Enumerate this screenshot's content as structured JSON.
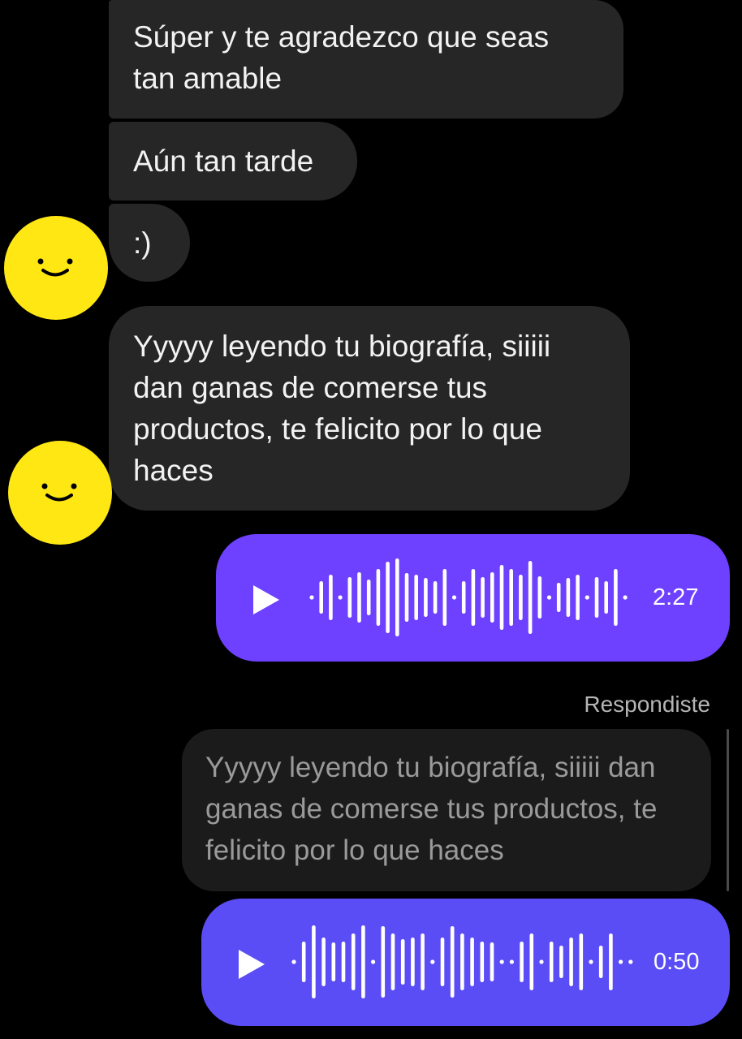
{
  "messages_received": [
    {
      "lines": [
        "Súper y te agradezco que seas",
        "tan amable"
      ]
    },
    {
      "lines": [
        "Aún tan tarde"
      ]
    },
    {
      "lines": [
        ":)"
      ]
    },
    {
      "lines": [
        "Yyyyy leyendo tu biografía, siiiii",
        "dan ganas de comerse tus",
        "productos, te felicito por lo que",
        "haces"
      ]
    }
  ],
  "avatar_icon": "smiley-face-icon",
  "avatar_color": "#FFE713",
  "voice_messages": [
    {
      "duration": "2:27",
      "color": "#6E40FF",
      "icon": "play-icon"
    },
    {
      "duration": "0:50",
      "color": "#5B4DF6",
      "icon": "play-icon"
    }
  ],
  "reply": {
    "label": "Respondiste",
    "quoted_lines": [
      "Yyyyy leyendo tu biografía, siiiii dan",
      "ganas de comerse tus productos, te",
      "felicito por lo que haces"
    ]
  }
}
